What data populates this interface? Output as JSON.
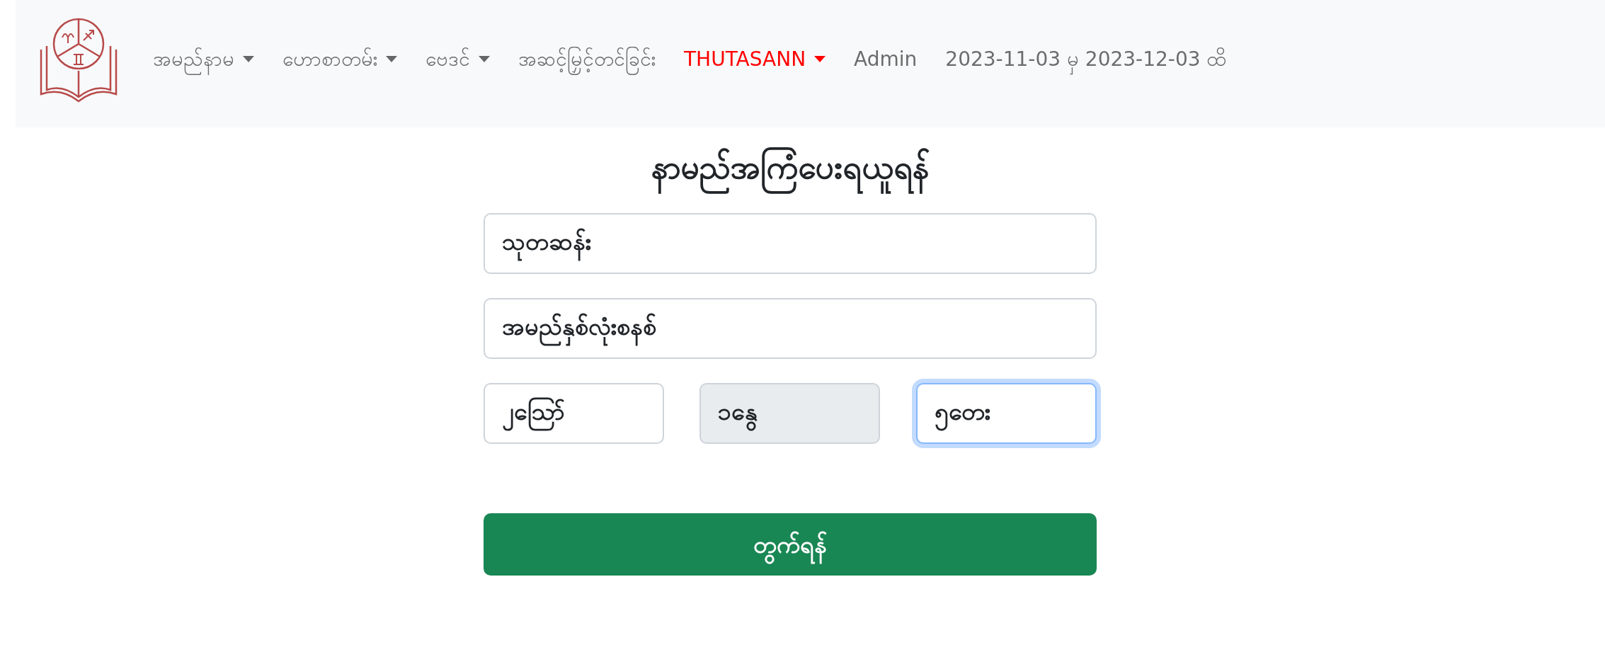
{
  "navbar": {
    "items": [
      {
        "label": "အမည်နာမ",
        "dropdown": true,
        "kind": "menu"
      },
      {
        "label": "ဟောစာတမ်း",
        "dropdown": true,
        "kind": "menu"
      },
      {
        "label": "ဗေဒင်",
        "dropdown": true,
        "kind": "menu"
      },
      {
        "label": "အဆင့်မြှင့်တင်ခြင်း",
        "dropdown": false,
        "kind": "menu"
      },
      {
        "label": "THUTASANN",
        "dropdown": true,
        "kind": "user"
      },
      {
        "label": "Admin",
        "dropdown": false,
        "kind": "text"
      },
      {
        "label": "2023-11-03 မှ 2023-12-03 ထိ",
        "dropdown": false,
        "kind": "text"
      }
    ]
  },
  "title": "နာမည်အကြံပေးရယူရန်",
  "fields": [
    {
      "value": "သုတဆန်း",
      "disabled": false,
      "focused": false
    },
    {
      "value": "အမည်နှစ်လုံးစနစ်",
      "disabled": false,
      "focused": false
    }
  ],
  "date_fields": [
    {
      "value": "၂ဪ",
      "disabled": false,
      "focused": false
    },
    {
      "value": "၁နွေ",
      "disabled": true,
      "focused": false
    },
    {
      "value": "၅တေး",
      "disabled": false,
      "focused": true
    }
  ],
  "submit_button": "တွက်ရန်"
}
